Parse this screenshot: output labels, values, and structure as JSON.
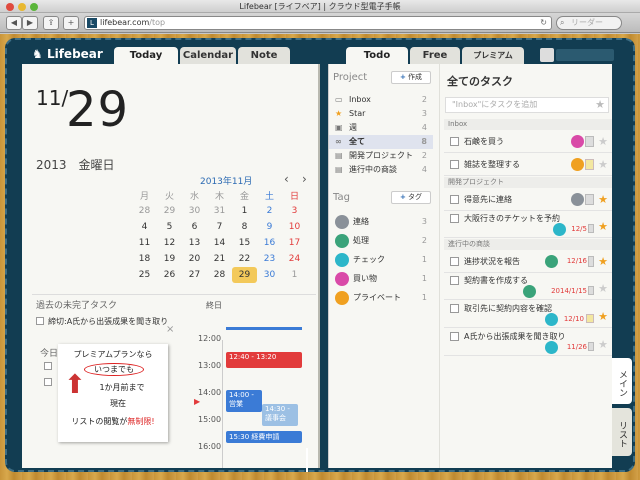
{
  "browser": {
    "title": "Lifebear [ライフベア] | クラウド型電子手帳",
    "url_host": "lifebear.com",
    "url_path": "/top",
    "search_placeholder": "リーダー"
  },
  "tabs": {
    "today": "Today",
    "calendar": "Calendar",
    "note": "Note",
    "todo": "Todo",
    "free": "Free",
    "premium": "プレミアム"
  },
  "logo": "Lifebear",
  "date": {
    "month": "11",
    "slash": "/",
    "day": "29",
    "year_weekday": "2013　金曜日"
  },
  "calendar": {
    "title": "2013年11月",
    "prev": "‹",
    "next": "›",
    "weekdays": [
      "月",
      "火",
      "水",
      "木",
      "金",
      "土",
      "日"
    ],
    "weeks": [
      [
        "28",
        "29",
        "30",
        "31",
        "1",
        "2",
        "3"
      ],
      [
        "4",
        "5",
        "6",
        "7",
        "8",
        "9",
        "10"
      ],
      [
        "11",
        "12",
        "13",
        "14",
        "15",
        "16",
        "17"
      ],
      [
        "18",
        "19",
        "20",
        "21",
        "22",
        "23",
        "24"
      ],
      [
        "25",
        "26",
        "27",
        "28",
        "29",
        "30",
        "1"
      ]
    ],
    "selected": "29"
  },
  "overdue": {
    "title": "過去の未完了タスク",
    "item": "締切:A氏から出張成果を聞き取り",
    "close": "×",
    "today_label": "今日"
  },
  "promo": {
    "l1": "プレミアムプランなら",
    "l2": "いつまでも",
    "l3": "1か月前まで",
    "l4": "現在",
    "l5": "リストの閲覧が",
    "l6": "無制限!"
  },
  "timeline": {
    "header": "終日",
    "times": [
      "12:00",
      "13:00",
      "14:00",
      "15:00",
      "16:00"
    ],
    "events": [
      "12:40 - 13:20",
      "14:00 -",
      "営業",
      "14:30 -",
      "議事会",
      "15:30 経費申請"
    ]
  },
  "project": {
    "title": "Project",
    "add": "作成",
    "items": [
      {
        "label": "Inbox",
        "count": "2"
      },
      {
        "label": "Star",
        "count": "3"
      },
      {
        "label": "週",
        "count": "4"
      },
      {
        "label": "全て",
        "count": "8"
      },
      {
        "label": "開発プロジェクト",
        "count": "2"
      },
      {
        "label": "進行中の商談",
        "count": "4"
      }
    ]
  },
  "tag": {
    "title": "Tag",
    "add": "タグ",
    "items": [
      {
        "label": "連絡",
        "count": "3"
      },
      {
        "label": "処理",
        "count": "2"
      },
      {
        "label": "チェック",
        "count": "1"
      },
      {
        "label": "買い物",
        "count": "1"
      },
      {
        "label": "プライベート",
        "count": "1"
      }
    ]
  },
  "tasks": {
    "title": "全てのタスク",
    "placeholder": "\"Inbox\"にタスクを追加",
    "sections": [
      "Inbox",
      "開発プロジェクト",
      "進行中の商談"
    ],
    "items": [
      {
        "label": "石鹸を買う",
        "date": ""
      },
      {
        "label": "雑誌を整理する",
        "date": ""
      },
      {
        "label": "得意先に連絡",
        "date": ""
      },
      {
        "label": "大阪行きのチケットを予約",
        "date": "12/5"
      },
      {
        "label": "進捗状況を報告",
        "date": "12/16"
      },
      {
        "label": "契約書を作成する",
        "date": "2014/1/15"
      },
      {
        "label": "取引先に契約内容を確認",
        "date": "12/10"
      },
      {
        "label": "A氏から出張成果を聞き取り",
        "date": "11/26"
      }
    ]
  },
  "side_tabs": {
    "main": "メイン",
    "list": "リスト"
  },
  "colors": {
    "cover": "#123d52",
    "accent": "#2d6bb3",
    "selected_day": "#f3c95a",
    "event_red": "#e23b3b",
    "event_blue": "#3b7bd6"
  }
}
